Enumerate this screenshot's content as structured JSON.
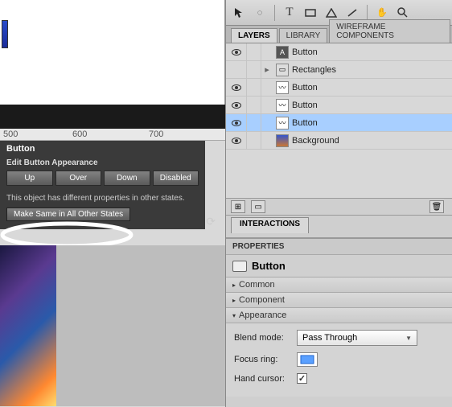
{
  "ruler": {
    "marks": [
      "500",
      "600",
      "700"
    ]
  },
  "button_panel": {
    "title": "Button",
    "subtitle": "Edit Button Appearance",
    "states": [
      "Up",
      "Over",
      "Down",
      "Disabled"
    ],
    "note": "This object has different properties in other states.",
    "make_same": "Make Same in All Other States"
  },
  "tabs": {
    "layers": "LAYERS",
    "library": "LIBRARY",
    "wireframe": "WIREFRAME COMPONENTS"
  },
  "layers": [
    {
      "visible": true,
      "expand": "",
      "name": "Button",
      "type": "button"
    },
    {
      "visible": false,
      "expand": "▸",
      "name": "Rectangles",
      "type": "folder"
    },
    {
      "visible": true,
      "expand": "",
      "name": "Button",
      "type": "swirl"
    },
    {
      "visible": true,
      "expand": "",
      "name": "Button",
      "type": "swirl"
    },
    {
      "visible": true,
      "expand": "",
      "name": "Button",
      "type": "swirl",
      "selected": true
    },
    {
      "visible": true,
      "expand": "",
      "name": "Background",
      "type": "image"
    }
  ],
  "interactions_tab": "INTERACTIONS",
  "properties": {
    "header": "PROPERTIES",
    "component": "Button",
    "sections": {
      "common": "Common",
      "component_s": "Component",
      "appearance": "Appearance"
    },
    "blend_label": "Blend mode:",
    "blend_value": "Pass Through",
    "focus_label": "Focus ring:",
    "hand_label": "Hand cursor:",
    "hand_checked": true
  }
}
